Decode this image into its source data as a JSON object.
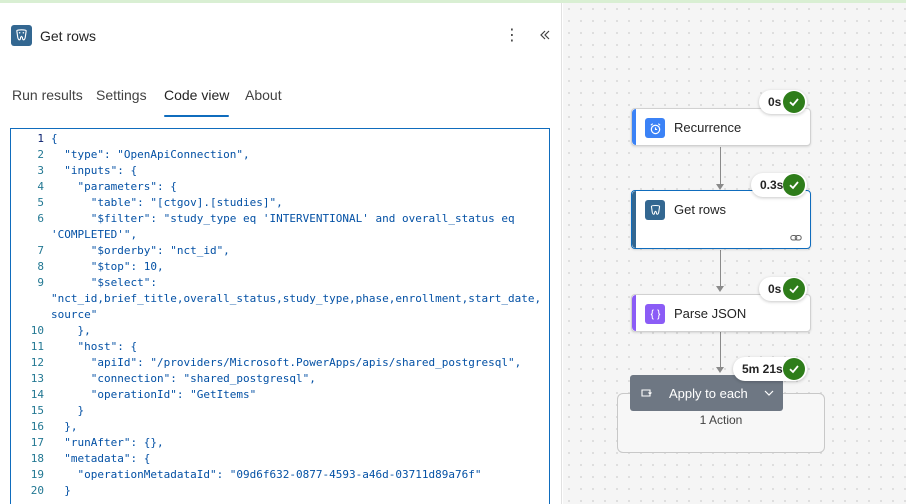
{
  "panel": {
    "title": "Get rows",
    "more_glyph": "⋮",
    "tabs": [
      {
        "label": "Run results"
      },
      {
        "label": "Settings"
      },
      {
        "label": "Code view",
        "active": true
      },
      {
        "label": "About"
      }
    ]
  },
  "code": {
    "lines": [
      {
        "num": "1",
        "text": "{"
      },
      {
        "num": "2",
        "text": "  \"type\": \"OpenApiConnection\","
      },
      {
        "num": "3",
        "text": "  \"inputs\": {"
      },
      {
        "num": "4",
        "text": "    \"parameters\": {"
      },
      {
        "num": "5",
        "text": "      \"table\": \"[ctgov].[studies]\","
      },
      {
        "num": "6",
        "text": "      \"$filter\": \"study_type eq 'INTERVENTIONAL' and overall_status eq"
      },
      {
        "num": "",
        "text": "'COMPLETED'\","
      },
      {
        "num": "7",
        "text": "      \"$orderby\": \"nct_id\","
      },
      {
        "num": "8",
        "text": "      \"$top\": 10,"
      },
      {
        "num": "9",
        "text": "      \"$select\":"
      },
      {
        "num": "",
        "text": "\"nct_id,brief_title,overall_status,study_type,phase,enrollment,start_date,"
      },
      {
        "num": "",
        "text": "source\""
      },
      {
        "num": "10",
        "text": "    },"
      },
      {
        "num": "11",
        "text": "    \"host\": {"
      },
      {
        "num": "12",
        "text": "      \"apiId\": \"/providers/Microsoft.PowerApps/apis/shared_postgresql\","
      },
      {
        "num": "13",
        "text": "      \"connection\": \"shared_postgresql\","
      },
      {
        "num": "14",
        "text": "      \"operationId\": \"GetItems\""
      },
      {
        "num": "15",
        "text": "    }"
      },
      {
        "num": "16",
        "text": "  },"
      },
      {
        "num": "17",
        "text": "  \"runAfter\": {},"
      },
      {
        "num": "18",
        "text": "  \"metadata\": {"
      },
      {
        "num": "19",
        "text": "    \"operationMetadataId\": \"09d6f632-0877-4593-a46d-03711d89a76f\""
      },
      {
        "num": "20",
        "text": "  }"
      }
    ]
  },
  "flow": {
    "nodes": [
      {
        "label": "Recurrence",
        "duration": "0s"
      },
      {
        "label": "Get rows",
        "duration": "0.3s"
      },
      {
        "label": "Parse JSON",
        "duration": "0s"
      }
    ],
    "scope": {
      "label": "Apply to each",
      "duration": "5m 21s",
      "count": "1 Action"
    }
  },
  "colors": {
    "accent_blue": "#0f6cbd",
    "success_green": "#2e7d1a",
    "recurrence_icon": "#3b82f6",
    "postgres_icon": "#336791",
    "parse_json_icon": "#8b5cf6",
    "scope_header": "#6e7783"
  },
  "icons": {
    "panel": "postgresql-icon",
    "recurrence": "alarm-clock-icon",
    "get_rows": "postgresql-icon",
    "parse_json": "braces-icon",
    "scope": "loop-icon",
    "status": "checkmark-icon"
  }
}
